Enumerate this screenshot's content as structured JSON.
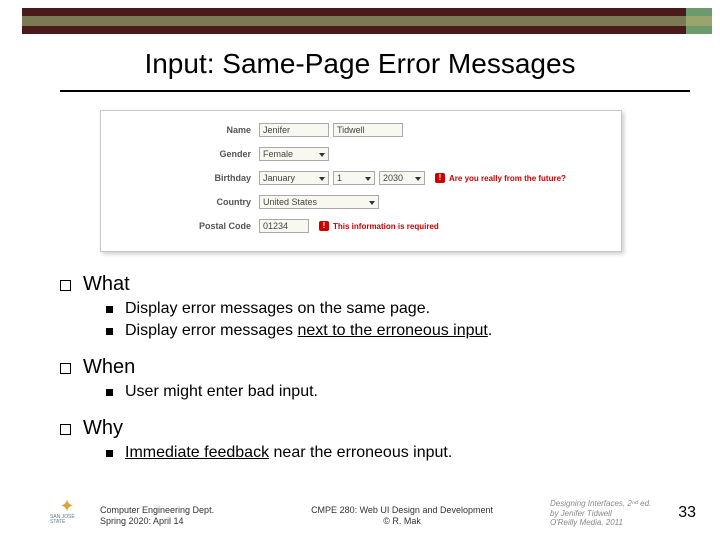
{
  "title": "Input: Same-Page Error Messages",
  "form": {
    "name_label": "Name",
    "first_name": "Jenifer",
    "last_name": "Tidwell",
    "gender_label": "Gender",
    "gender": "Female",
    "birthday_label": "Birthday",
    "birthday_month": "January",
    "birthday_day": "1",
    "birthday_year": "2030",
    "birthday_error": "Are you really from the future?",
    "country_label": "Country",
    "country": "United States",
    "postal_label": "Postal Code",
    "postal": "01234",
    "postal_error": "This information is required"
  },
  "sections": {
    "what": {
      "heading": "What",
      "items": [
        "Display error messages on the same page.",
        "Display error messages next to the erroneous input."
      ]
    },
    "when": {
      "heading": "When",
      "items": [
        "User might enter bad input."
      ]
    },
    "why": {
      "heading": "Why",
      "items": [
        "Immediate feedback near the erroneous input."
      ]
    }
  },
  "footer": {
    "dept_line1": "Computer Engineering Dept.",
    "dept_line2": "Spring 2020: April 14",
    "center_line1": "CMPE 280: Web UI Design and Development",
    "center_line2": "© R. Mak",
    "ref_line1": "Designing Interfaces, 2ⁿᵈ ed.",
    "ref_line2": "by Jenifer Tidwell",
    "ref_line3": "O'Reilly Media, 2011",
    "logo_text": "SAN JOSÉ STATE"
  },
  "page_number": "33"
}
